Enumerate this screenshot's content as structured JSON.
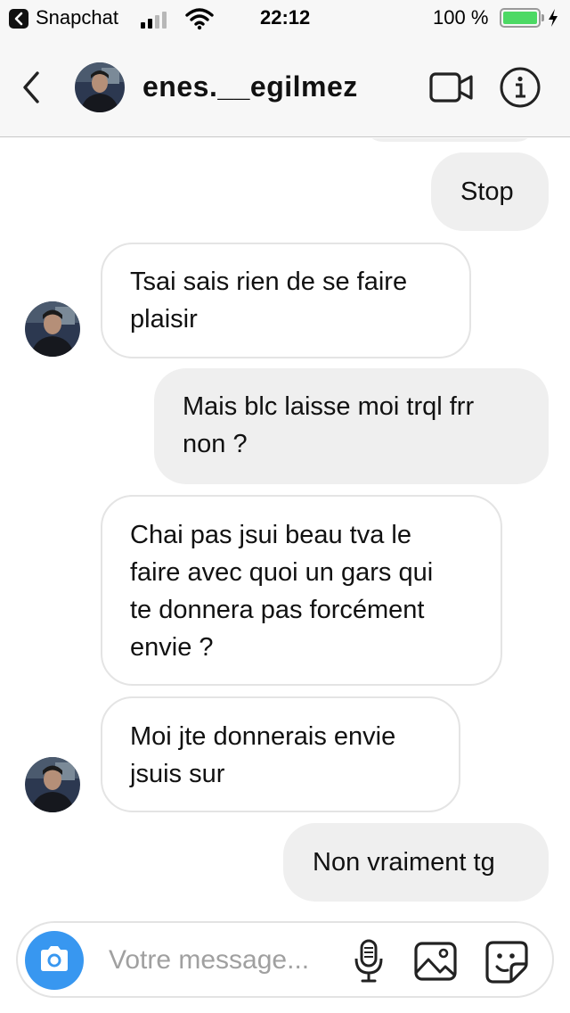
{
  "status_bar": {
    "back_app": "Snapchat",
    "time": "22:12",
    "battery_text": "100 %",
    "battery_level": 1.0,
    "battery_color": "#4cd964",
    "icons": [
      "back-to-app-icon",
      "signal-icon",
      "wifi-icon",
      "battery-icon",
      "charging-bolt-icon"
    ]
  },
  "header": {
    "username": "enes.__egilmez",
    "icons": [
      "chevron-left-icon",
      "avatar",
      "video-camera-icon",
      "info-icon"
    ]
  },
  "messages": [
    {
      "direction": "outgoing",
      "text": "Stop"
    },
    {
      "direction": "incoming",
      "text": "Tsai sais rien de se faire plaisir",
      "lines": [
        "Tsai sais rien de se faire",
        "plaisir"
      ],
      "avatar": true
    },
    {
      "direction": "outgoing",
      "text": "Mais blc laisse moi trql frr non ?",
      "lines": [
        "Mais blc laisse moi trql frr",
        "non ?"
      ]
    },
    {
      "direction": "incoming",
      "text": "Chai pas jsui beau tva le faire avec quoi un gars qui te donnera pas forcément envie ?",
      "lines": [
        "Chai pas jsui beau tva le",
        "faire avec quoi un gars qui",
        "te donnera pas forcément",
        "envie ?"
      ]
    },
    {
      "direction": "incoming",
      "text": "Moi jte donnerais envie jsuis sur",
      "lines": [
        "Moi jte donnerais envie",
        "jsuis sur"
      ],
      "avatar": true
    },
    {
      "direction": "outgoing",
      "text": "Non vraiment tg"
    }
  ],
  "composer": {
    "placeholder": "Votre message...",
    "icons": [
      "camera-icon",
      "microphone-icon",
      "gallery-icon",
      "sticker-icon"
    ],
    "accent_color": "#3897f0"
  }
}
